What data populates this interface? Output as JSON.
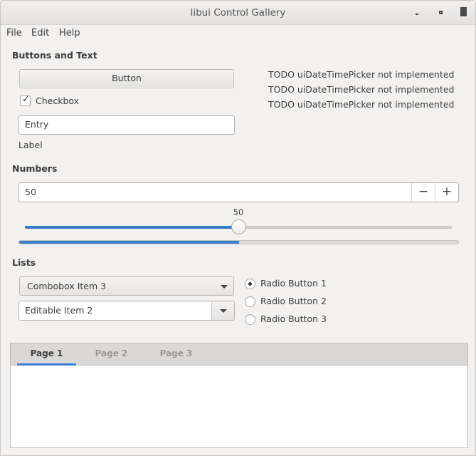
{
  "window": {
    "title": "libui Control Gallery"
  },
  "menu": {
    "items": [
      "File",
      "Edit",
      "Help"
    ]
  },
  "buttons_and_text": {
    "section_title": "Buttons and Text",
    "button_label": "Button",
    "checkbox": {
      "label": "Checkbox",
      "checked": true
    },
    "entry_value": "Entry",
    "label_text": "Label",
    "todo_lines": [
      "TODO uiDateTimePicker not implemented",
      "TODO uiDateTimePicker not implemented",
      "TODO uiDateTimePicker not implemented"
    ]
  },
  "numbers": {
    "section_title": "Numbers",
    "spinbox_value": "50",
    "decrement_symbol": "−",
    "increment_symbol": "+",
    "slider": {
      "value_label": "50",
      "value": 50,
      "min": 0,
      "max": 100
    },
    "progress": {
      "value": 50,
      "max": 100
    }
  },
  "lists": {
    "section_title": "Lists",
    "combobox_selected": "Combobox Item 3",
    "editable_combobox_value": "Editable Item 2",
    "radio_buttons": [
      {
        "label": "Radio Button 1",
        "selected": true
      },
      {
        "label": "Radio Button 2",
        "selected": false
      },
      {
        "label": "Radio Button 3",
        "selected": false
      }
    ]
  },
  "tabs": {
    "items": [
      {
        "label": "Page 1",
        "active": true
      },
      {
        "label": "Page 2",
        "active": false
      },
      {
        "label": "Page 3",
        "active": false
      }
    ]
  },
  "colors": {
    "accent": "#3a80d0",
    "window_bg": "#f2f1f0",
    "text": "#3c3c3c",
    "inactive_tab_text": "#9a9896"
  }
}
